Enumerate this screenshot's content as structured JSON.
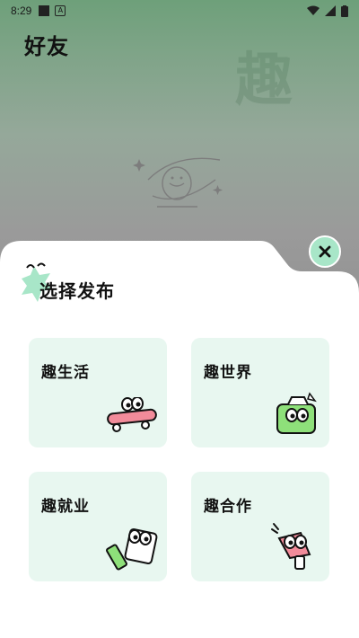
{
  "status_bar": {
    "time": "8:29"
  },
  "page": {
    "title": "好友",
    "watermark": "趣"
  },
  "sheet": {
    "title": "选择发布",
    "options": [
      {
        "label": "趣生活",
        "illustration": "skateboard-icon"
      },
      {
        "label": "趣世界",
        "illustration": "camera-icon"
      },
      {
        "label": "趣就业",
        "illustration": "tool-box-icon"
      },
      {
        "label": "趣合作",
        "illustration": "megaphone-icon"
      }
    ]
  },
  "colors": {
    "accent": "#a8e6c8",
    "card_bg": "#e8f7f0",
    "header_green": "#6ea07a"
  }
}
